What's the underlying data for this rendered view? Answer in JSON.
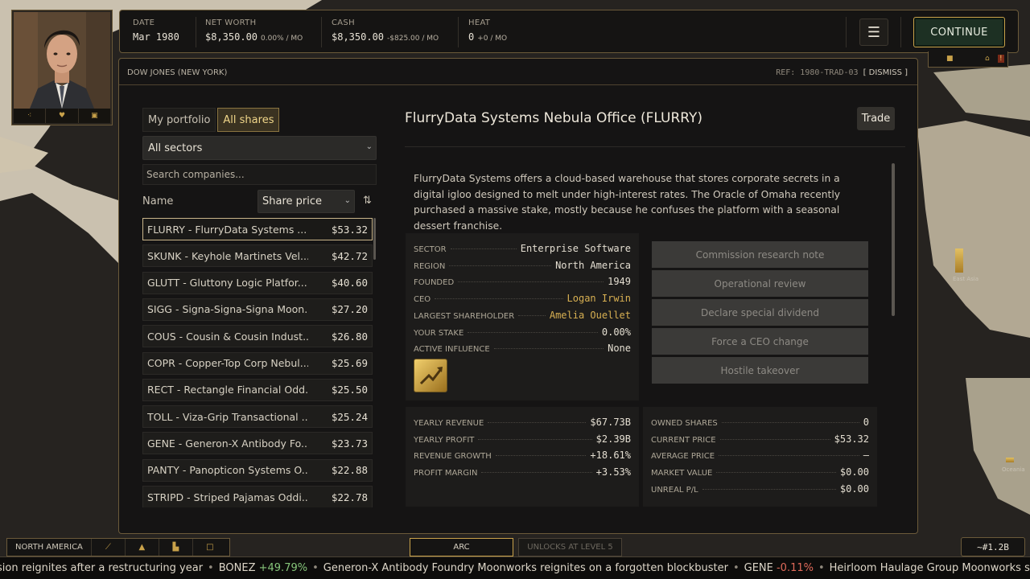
{
  "header": {
    "date_label": "DATE",
    "date_value": "Mar 1980",
    "networth_label": "NET WORTH",
    "networth_value": "$8,350.00",
    "networth_delta": "0.00% / MO",
    "cash_label": "CASH",
    "cash_value": "$8,350.00",
    "cash_delta": "-$825.00 / MO",
    "heat_label": "HEAT",
    "heat_value": "0",
    "heat_delta": "+0 / MO",
    "menu_icon": "hamburger-icon",
    "continue_label": "CONTINUE"
  },
  "panel": {
    "title": "DOW JONES (NEW YORK)",
    "ref": "REF: 1980-TRAD-03",
    "dismiss_label": "[ DISMISS ]"
  },
  "tabs": [
    {
      "label": "My portfolio",
      "active": false
    },
    {
      "label": "All shares",
      "active": true
    }
  ],
  "filters": {
    "sector_value": "All sectors",
    "search_placeholder": "Search companies...",
    "name_header": "Name",
    "sort_value": "Share price",
    "sort_toggle": "⇅"
  },
  "stocks": [
    {
      "name": "FLURRY - FlurryData Systems ...",
      "price": "$53.32",
      "selected": true
    },
    {
      "name": "SKUNK - Keyhole Martinets Vel...",
      "price": "$42.72"
    },
    {
      "name": "GLUTT - Gluttony Logic Platfor...",
      "price": "$40.60"
    },
    {
      "name": "SIGG - Signa-Signa-Signa Moon...",
      "price": "$27.20"
    },
    {
      "name": "COUS - Cousin & Cousin Indust...",
      "price": "$26.80"
    },
    {
      "name": "COPR - Copper-Top Corp Nebul...",
      "price": "$25.69"
    },
    {
      "name": "RECT - Rectangle Financial Odd...",
      "price": "$25.50"
    },
    {
      "name": "TOLL - Viza-Grip Transactional ...",
      "price": "$25.24"
    },
    {
      "name": "GENE - Generon-X Antibody Fo...",
      "price": "$23.73"
    },
    {
      "name": "PANTY - Panopticon Systems O...",
      "price": "$22.88"
    },
    {
      "name": "STRIPD - Striped Pajamas Oddi...",
      "price": "$22.78"
    }
  ],
  "company": {
    "title": "FlurryData Systems Nebula Office (FLURRY)",
    "trade_label": "Trade",
    "description": "FlurryData Systems offers a cloud-based warehouse that stores corporate secrets in a digital igloo designed to melt under high-interest rates. The Oracle of Omaha recently purchased a massive stake, mostly because he confuses the platform with a seasonal dessert franchise.",
    "info": [
      {
        "label": "SECTOR",
        "value": "Enterprise Software"
      },
      {
        "label": "REGION",
        "value": "North America"
      },
      {
        "label": "FOUNDED",
        "value": "1949"
      },
      {
        "label": "CEO",
        "value": "Logan Irwin",
        "gold": true
      },
      {
        "label": "LARGEST SHAREHOLDER",
        "value": "Amelia Ouellet",
        "gold": true
      },
      {
        "label": "YOUR STAKE",
        "value": "0.00%"
      },
      {
        "label": "ACTIVE INFLUENCE",
        "value": "None"
      }
    ],
    "influence_icon": "rocket-chart-icon",
    "actions": [
      "Commission research note",
      "Operational review",
      "Declare special dividend",
      "Force a CEO change",
      "Hostile takeover"
    ],
    "financials": [
      {
        "label": "YEARLY REVENUE",
        "value": "$67.73B"
      },
      {
        "label": "YEARLY PROFIT",
        "value": "$2.39B"
      },
      {
        "label": "REVENUE GROWTH",
        "value": "+18.61%"
      },
      {
        "label": "PROFIT MARGIN",
        "value": "+3.53%"
      }
    ],
    "holdings": [
      {
        "label": "OWNED SHARES",
        "value": "0"
      },
      {
        "label": "CURRENT PRICE",
        "value": "$53.32"
      },
      {
        "label": "AVERAGE PRICE",
        "value": "–"
      },
      {
        "label": "MARKET VALUE",
        "value": "$0.00"
      },
      {
        "label": "UNREAL P/L",
        "value": "$0.00"
      }
    ]
  },
  "bottom": {
    "region_label": "NORTH AMERICA",
    "region_icons": [
      "chart-icon",
      "warning-icon",
      "factory-icon",
      "box-icon"
    ],
    "arc_label": "ARC",
    "unlocks_label": "UNLOCKS AT LEVEL 5",
    "cash_badge": "~#1.2B"
  },
  "map_labels": {
    "east_asia": "East Asia",
    "oceania": "Oceania"
  },
  "ticker": [
    {
      "text": "sion reignites after a restructuring year"
    },
    {
      "symbol": "BONEZ",
      "change": "+49.79%",
      "dir": "up"
    },
    {
      "text": "Generon-X Antibody Foundry Moonworks reignites on a forgotten blockbuster"
    },
    {
      "symbol": "GENE",
      "change": "-0.11%",
      "dir": "down"
    },
    {
      "text": "Heirloom Haulage Group Moonworks surprises wit"
    }
  ],
  "colors": {
    "accent_gold": "#c9a24a",
    "positive": "#86c57a",
    "negative": "#e06a5a"
  }
}
